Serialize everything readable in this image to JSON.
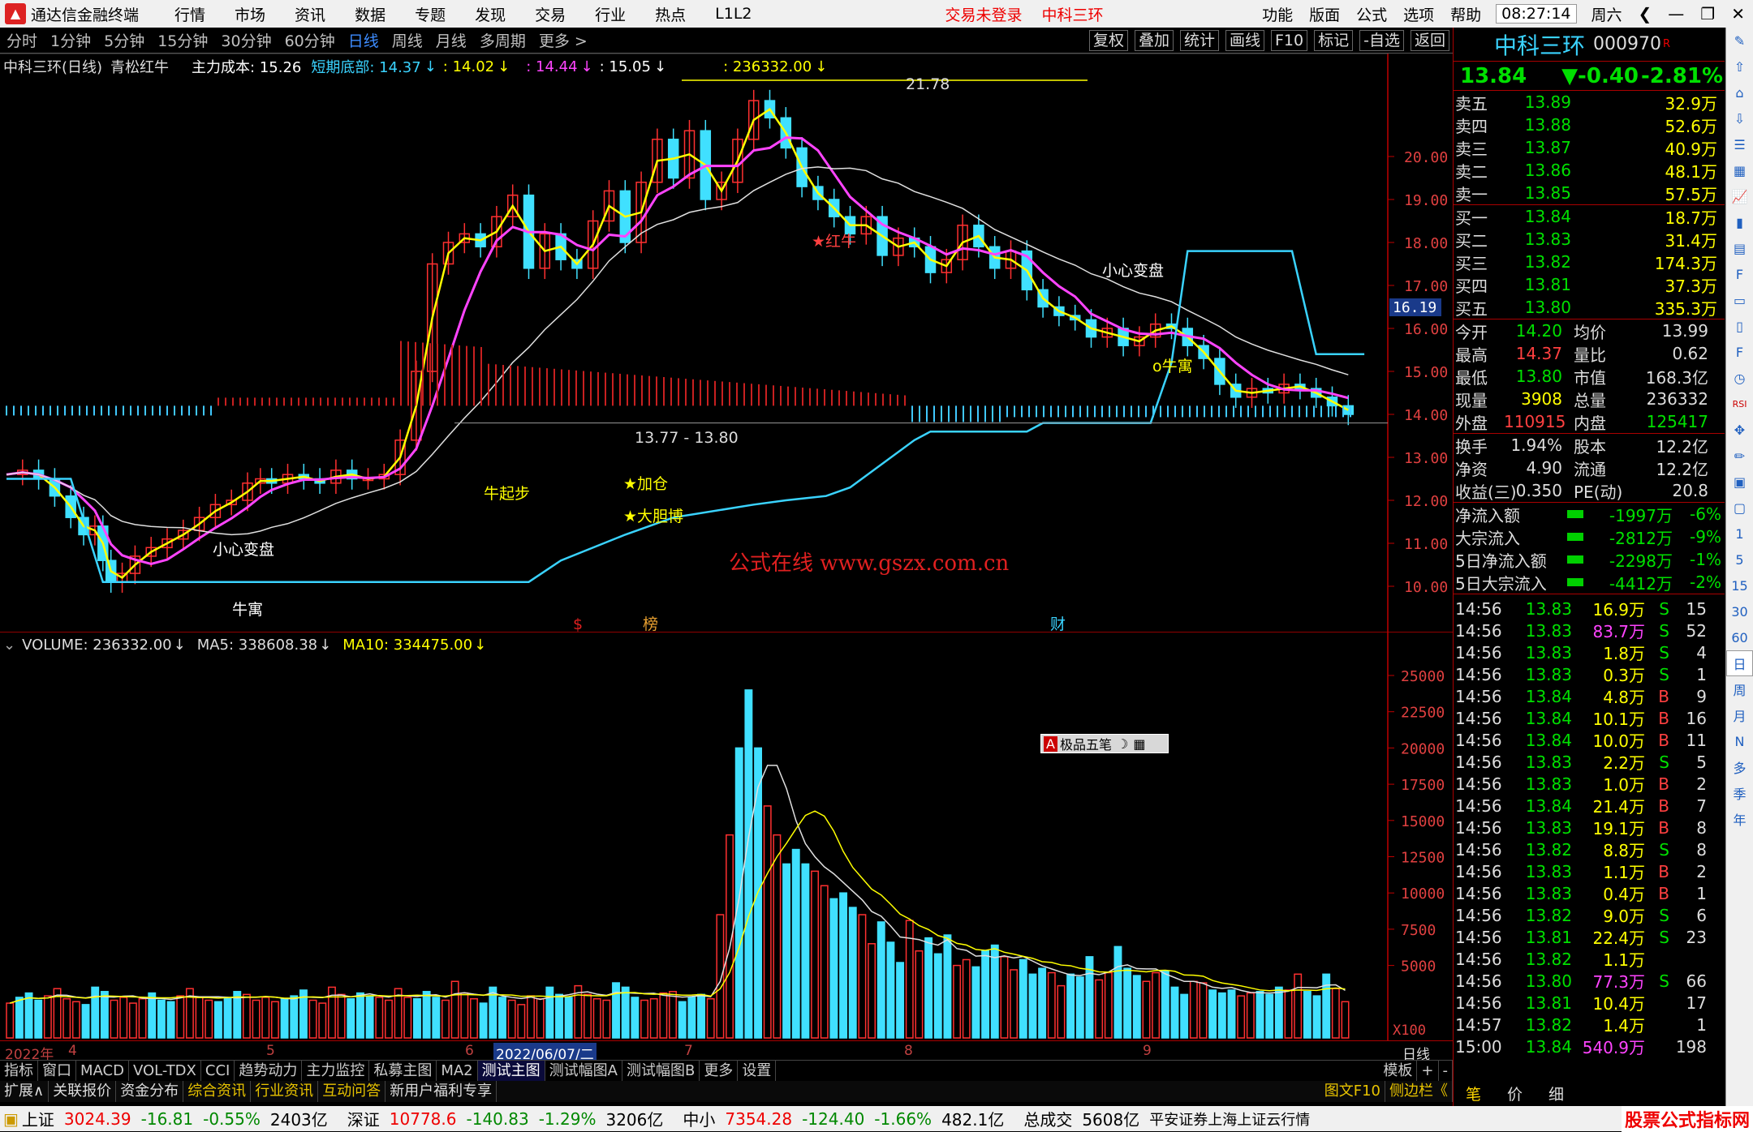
{
  "menubar": {
    "app": "通达信金融终端",
    "items": [
      "行情",
      "市场",
      "资讯",
      "数据",
      "专题",
      "发现",
      "交易",
      "行业",
      "热点",
      "L1L2"
    ],
    "trade_status": "交易未登录",
    "stock_title": "中科三环",
    "right_items": [
      "功能",
      "版面",
      "公式",
      "选项",
      "帮助"
    ],
    "time": "08:27:14",
    "weekday": "周六"
  },
  "toolbar": {
    "periods": [
      "分时",
      "1分钟",
      "5分钟",
      "15分钟",
      "30分钟",
      "60分钟",
      "日线",
      "周线",
      "月线",
      "多周期",
      "更多 >"
    ],
    "active": "日线",
    "right": [
      "复权",
      "叠加",
      "统计",
      "画线",
      "F10",
      "标记",
      "-自选",
      "返回"
    ]
  },
  "chart_header": {
    "title": "中科三环(日线)",
    "indicator": "青松红牛",
    "items": [
      {
        "label": "主力成本: 15.26",
        "color": "#ffffff"
      },
      {
        "label": "短期底部: 14.37",
        "color": "#3ad3ff"
      },
      {
        "label": ": 14.02",
        "color": "#ffff00"
      },
      {
        "label": ": 14.44",
        "color": "#ff44ff"
      },
      {
        "label": ": 15.05",
        "color": "#ffffff"
      },
      {
        "label": ": 236332.00",
        "color": "#ffff00"
      }
    ]
  },
  "price_axis": {
    "ticks": [
      "20.00",
      "19.00",
      "18.00",
      "17.00",
      "16.00",
      "15.00",
      "14.00",
      "13.00",
      "12.00",
      "11.00",
      "10.00"
    ],
    "current": "16.19"
  },
  "annotations": {
    "high": "21.78",
    "low_range": "13.77 - 13.80",
    "labels": [
      "小心变盘",
      "牛寓",
      "牛起步",
      "加仓",
      "大胆博",
      "红牛",
      "小心变盘",
      "牛寓"
    ],
    "watermark": "公式在线  www.gszx.com.cn",
    "markers": [
      "$",
      "榜",
      "财"
    ]
  },
  "volume_header": {
    "vol": "VOLUME: 236332.00",
    "ma5": "MA5: 338608.38",
    "ma10": "MA10: 334475.00"
  },
  "volume_axis": {
    "ticks": [
      "25000",
      "22500",
      "20000",
      "17500",
      "15000",
      "12500",
      "10000",
      "7500",
      "5000"
    ],
    "unit": "X100"
  },
  "popup": {
    "label": "极品五笔"
  },
  "datebar": {
    "year": "2022年",
    "months": [
      "4",
      "5",
      "6",
      "7",
      "8",
      "9"
    ],
    "selected": "2022/06/07/二",
    "period": "日线"
  },
  "tabs1": [
    "指标",
    "窗口",
    "MACD",
    "VOL-TDX",
    "CCI",
    "趋势动力",
    "主力监控",
    "私募主图",
    "MA2",
    "测试主图",
    "测试幅图A",
    "测试幅图B",
    "更多",
    "设置"
  ],
  "tabs1_right": [
    "模板",
    "+",
    "-"
  ],
  "tabs2": [
    "扩展∧",
    "关联报价",
    "资金分布",
    "综合资讯",
    "行业资讯",
    "互动问答",
    "新用户福利专享"
  ],
  "tabs2_right": [
    "图文F10",
    "侧边栏《"
  ],
  "quote": {
    "name": "中科三环",
    "code": "000970",
    "tag": "R",
    "price": "13.84",
    "change": "▼-0.40",
    "pct": "-2.81%",
    "asks": [
      [
        "卖五",
        "13.89",
        "32.9万"
      ],
      [
        "卖四",
        "13.88",
        "52.6万"
      ],
      [
        "卖三",
        "13.87",
        "40.9万"
      ],
      [
        "卖二",
        "13.86",
        "48.1万"
      ],
      [
        "卖一",
        "13.85",
        "57.5万"
      ]
    ],
    "bids": [
      [
        "买一",
        "13.84",
        "18.7万"
      ],
      [
        "买二",
        "13.83",
        "31.4万"
      ],
      [
        "买三",
        "13.82",
        "174.3万"
      ],
      [
        "买四",
        "13.81",
        "37.3万"
      ],
      [
        "买五",
        "13.80",
        "335.3万"
      ]
    ],
    "stats": [
      [
        "今开",
        "14.20",
        "均价",
        "13.99"
      ],
      [
        "最高",
        "14.37",
        "量比",
        "0.62"
      ],
      [
        "最低",
        "13.80",
        "市值",
        "168.3亿"
      ],
      [
        "现量",
        "3908",
        "总量",
        "236332"
      ],
      [
        "外盘",
        "110915",
        "内盘",
        "125417"
      ]
    ],
    "stats2": [
      [
        "换手",
        "1.94%",
        "股本",
        "12.2亿"
      ],
      [
        "净资",
        "4.90",
        "流通",
        "12.2亿"
      ],
      [
        "收益(三)",
        "0.350",
        "PE(动)",
        "20.8"
      ]
    ],
    "flows": [
      [
        "净流入额",
        "-1997万",
        "-6%"
      ],
      [
        "大宗流入",
        "-2812万",
        "-9%"
      ],
      [
        "5日净流入额",
        "-2298万",
        "-1%"
      ],
      [
        "5日大宗流入",
        "-4412万",
        "-2%"
      ]
    ],
    "ticks": [
      [
        "14:56",
        "13.83",
        "16.9万",
        "S",
        "15"
      ],
      [
        "14:56",
        "13.83",
        "83.7万",
        "S",
        "52"
      ],
      [
        "14:56",
        "13.83",
        "1.8万",
        "S",
        "4"
      ],
      [
        "14:56",
        "13.83",
        "0.3万",
        "S",
        "1"
      ],
      [
        "14:56",
        "13.84",
        "4.8万",
        "B",
        "9"
      ],
      [
        "14:56",
        "13.84",
        "10.1万",
        "B",
        "16"
      ],
      [
        "14:56",
        "13.84",
        "10.0万",
        "B",
        "11"
      ],
      [
        "14:56",
        "13.83",
        "2.2万",
        "S",
        "5"
      ],
      [
        "14:56",
        "13.83",
        "1.0万",
        "B",
        "2"
      ],
      [
        "14:56",
        "13.84",
        "21.4万",
        "B",
        "7"
      ],
      [
        "14:56",
        "13.83",
        "19.1万",
        "B",
        "8"
      ],
      [
        "14:56",
        "13.82",
        "8.8万",
        "S",
        "8"
      ],
      [
        "14:56",
        "13.83",
        "1.1万",
        "B",
        "2"
      ],
      [
        "14:56",
        "13.83",
        "0.4万",
        "B",
        "1"
      ],
      [
        "14:56",
        "13.82",
        "9.0万",
        "S",
        "6"
      ],
      [
        "14:56",
        "13.81",
        "22.4万",
        "S",
        "23"
      ],
      [
        "14:56",
        "13.82",
        "1.1万",
        "",
        ""
      ],
      [
        "14:56",
        "13.80",
        "77.3万",
        "S",
        "66"
      ],
      [
        "14:56",
        "13.81",
        "10.4万",
        "",
        "17"
      ],
      [
        "14:57",
        "13.82",
        "1.4万",
        "",
        "1"
      ],
      [
        "15:00",
        "13.84",
        "540.9万",
        "",
        "198"
      ]
    ],
    "footer": [
      "笔",
      "价",
      "细"
    ]
  },
  "sidebar": [
    "1",
    "5",
    "15",
    "30",
    "60",
    "日",
    "周",
    "月",
    "N",
    "多",
    "季",
    "年"
  ],
  "statusbar": {
    "items": [
      {
        "name": "上证",
        "val": "3024.39",
        "chg": "-16.81",
        "pct": "-0.55%",
        "amt": "2403亿"
      },
      {
        "name": "深证",
        "val": "10778.6",
        "chg": "-140.83",
        "pct": "-1.29%",
        "amt": "3206亿"
      },
      {
        "name": "中小",
        "val": "7354.28",
        "chg": "-124.40",
        "pct": "-1.66%",
        "amt": "482.1亿"
      }
    ],
    "total_label": "总成交",
    "total": "5608亿",
    "broker": "平安证券上海上证云行情",
    "brand": "股票公式指标网",
    "brand_url": "www.gupiaozhibiao.com"
  }
}
